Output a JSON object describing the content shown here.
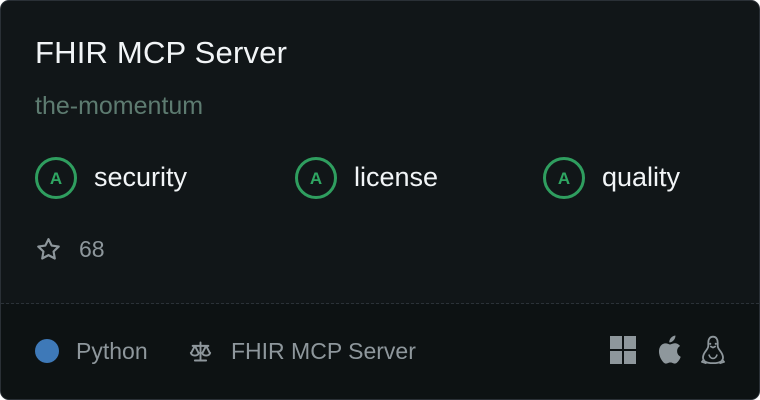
{
  "card": {
    "title": "FHIR MCP Server",
    "owner": "the-momentum",
    "scores": [
      {
        "grade": "A",
        "label": "security"
      },
      {
        "grade": "A",
        "label": "license"
      },
      {
        "grade": "A",
        "label": "quality"
      }
    ],
    "stars": "68",
    "footer": {
      "language": "Python",
      "language_color": "#3e79b8",
      "license_name": "FHIR MCP Server",
      "platforms": [
        "windows-icon",
        "apple-icon",
        "linux-icon"
      ]
    }
  },
  "colors": {
    "background": "#111618",
    "footer_background": "#0d1213",
    "grade_green": "#2fa662",
    "title_text": "#f2f5f7",
    "owner_text": "#5d7b70",
    "muted_text": "#8e979c"
  }
}
